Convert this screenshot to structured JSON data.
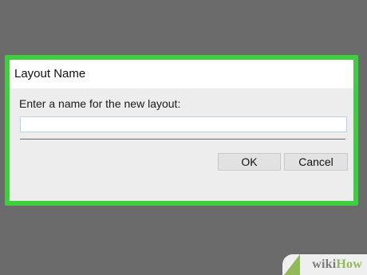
{
  "dialog": {
    "title": "Layout Name",
    "prompt": "Enter a name for the new layout:",
    "name_input": {
      "value": "",
      "placeholder": ""
    },
    "ok_label": "OK",
    "cancel_label": "Cancel"
  },
  "watermark": {
    "part1": "wiki",
    "part2": "How"
  },
  "colors": {
    "highlight": "#3ecf3e",
    "background": "#6b6b6b",
    "dialog_body": "#eeedee",
    "titlebar": "#ffffff",
    "brand_green": "#93b85a"
  }
}
